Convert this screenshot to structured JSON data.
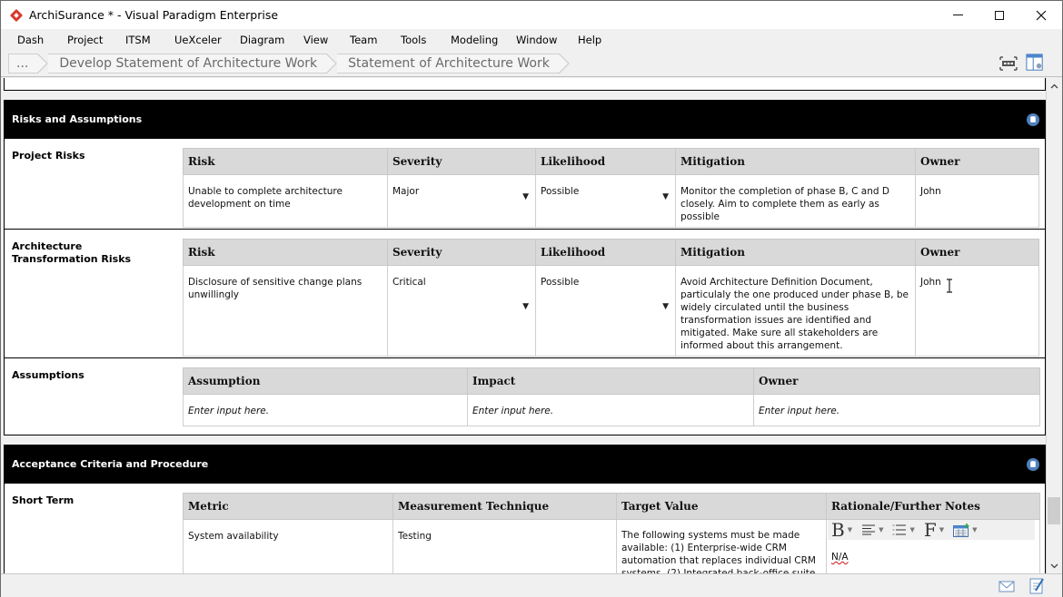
{
  "window": {
    "title": "ArchiSurance * - Visual Paradigm Enterprise",
    "controls": {
      "minimize": "minimize-icon",
      "maximize": "maximize-icon",
      "close": "close-icon"
    }
  },
  "menu": [
    "Dash",
    "Project",
    "ITSM",
    "UeXceler",
    "Diagram",
    "View",
    "Team",
    "Tools",
    "Modeling",
    "Window",
    "Help"
  ],
  "breadcrumb": {
    "items": [
      "...",
      "Develop Statement of Architecture Work",
      "Statement of Architecture Work"
    ]
  },
  "toolbar_icons": [
    "fit-diagram-icon",
    "panel-layout-icon"
  ],
  "sections": {
    "risks": {
      "title": "Risks and Assumptions",
      "project_risks": {
        "label": "Project Risks",
        "headers": [
          "Risk",
          "Severity",
          "Likelihood",
          "Mitigation",
          "Owner"
        ],
        "rows": [
          {
            "risk": "Unable to complete architecture development on time",
            "severity": "Major",
            "likelihood": "Possible",
            "mitigation": "Monitor the completion of phase B, C and D closely. Aim to complete them as early as possible",
            "owner": "John"
          }
        ]
      },
      "transformation_risks": {
        "label": "Architecture Transformation Risks",
        "headers": [
          "Risk",
          "Severity",
          "Likelihood",
          "Mitigation",
          "Owner"
        ],
        "rows": [
          {
            "risk": "Disclosure of sensitive change plans unwillingly",
            "severity": "Critical",
            "likelihood": "Possible",
            "mitigation": "Avoid Architecture Definition Document, particulaly the one produced under phase B, be widely circulated until the business transformation issues are identified and mitigated. Make sure all stakeholders are informed about this arrangement.",
            "owner": "John"
          }
        ]
      },
      "assumptions": {
        "label": "Assumptions",
        "headers": [
          "Assumption",
          "Impact",
          "Owner"
        ],
        "placeholder": "Enter input here."
      }
    },
    "acceptance": {
      "title": "Acceptance Criteria and Procedure",
      "short_term": {
        "label": "Short Term",
        "headers": [
          "Metric",
          "Measurement Technique",
          "Target Value",
          "Rationale/Further Notes"
        ],
        "rows": [
          {
            "metric": "System availability",
            "technique": "Testing",
            "target": "The following systems must be made available: (1) Enterprise-wide CRM automation that replaces individual CRM systems. (2) Integrated back-office suite that",
            "notes": "N/A"
          }
        ],
        "editor_toolbar": {
          "bold": "B",
          "font": "F",
          "more": "»",
          "icons": [
            "bold-icon",
            "align-icon",
            "list-icon",
            "font-icon",
            "table-icon",
            "more-icon"
          ]
        }
      }
    }
  },
  "statusbar_icons": [
    "mail-icon",
    "edit-document-icon"
  ]
}
